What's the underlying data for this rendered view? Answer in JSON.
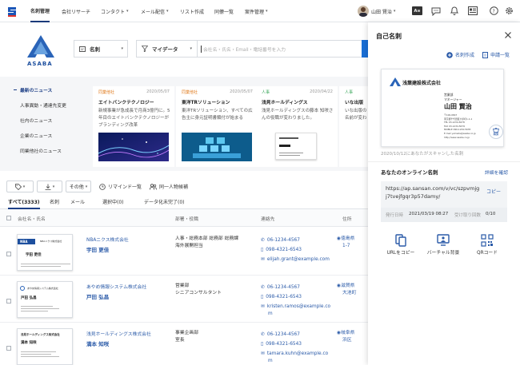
{
  "topnav": {
    "items": [
      "名刺管理",
      "会社リサーチ",
      "コンタクト",
      "メール配信",
      "リスト作成",
      "同僚一覧",
      "案件管理"
    ],
    "user_name": "山田 賢治",
    "caret": "▾"
  },
  "search": {
    "type_label": "名刺",
    "filter_label": "マイデータ",
    "placeholder": "会社名・氏名・Email・電話番号を入力"
  },
  "brand": {
    "logo_text": "ASABA"
  },
  "news_nav": [
    "最新のニュース",
    "人事異動・通達先変更",
    "社内のニュース",
    "企業のニュース",
    "同業他社のニュース"
  ],
  "news_cards": [
    {
      "tag": "同業他社",
      "date": "2020/05/07",
      "title": "エイトバンクテクノロジー",
      "body": "新規事業が急成長で月商3億円に。5年目のエイトバンクテクノロジーがブランディング改革"
    },
    {
      "tag": "同業他社",
      "date": "2020/05/07",
      "title": "東洋TRソリューション",
      "body": "東洋TRソリューション、すべての広告主に身元証明書類付が始まる"
    },
    {
      "tag": "人事",
      "date": "2020/04/22",
      "title": "浅見ホールディングス",
      "body": "浅見ホールディングスの藤本 知咲さんの役職が変わりました。"
    },
    {
      "tag": "人事",
      "date": "",
      "title": "いな出版",
      "body": "いな出版の名前が変わりました。"
    }
  ],
  "toolbar": {
    "tag_label": "",
    "download_label": "",
    "other_label": "その他",
    "reminder_label": "リマインド一覧",
    "same_person_label": "同一人物候補"
  },
  "tabs": [
    "すべて(3333)",
    "名刺",
    "メール",
    "選択中(0)",
    "データ化未完了(0)"
  ],
  "table": {
    "headers": [
      "会社名・氏名",
      "部署・役職",
      "連絡先",
      "住所"
    ],
    "rows": [
      {
        "company": "NBAニクス株式会社",
        "name": "宇田 更佳",
        "dept": [
          "人事・総務本部 総務部 総務課",
          "海外展開担当"
        ],
        "phone": "06-1234-4567",
        "mobile": "098-4321-6543",
        "email": "elijah.grant@example.com",
        "addr": [
          "徳島県",
          "1-7"
        ],
        "card_company": "NBAニクス株式会社",
        "card_name": "宇田 更佳"
      },
      {
        "company": "あやめ情報システム株式会社",
        "name": "戸田 弘昌",
        "dept": [
          "営業部",
          "シニアコンサルタント"
        ],
        "phone": "06-1234-4567",
        "mobile": "098-4321-6543",
        "email": "kristen.ramos@example.co",
        "email2": "m",
        "addr": [
          "滋賀県",
          "大池町"
        ],
        "card_company": "あやめ情報システム株式会社",
        "card_name": "戸田 弘昌"
      },
      {
        "company": "浅見ホールディングス株式会社",
        "name": "満本 知咲",
        "dept": [
          "事業企画部",
          "室長"
        ],
        "phone": "06-1234-4567",
        "mobile": "098-4321-6543",
        "email": "tamara.kuhn@example.co",
        "email2": "m",
        "addr": [
          "岐阜県",
          "浜区"
        ],
        "card_company": "浅見ホールディングス株式会社",
        "card_name": "満本 知咲"
      }
    ]
  },
  "panel": {
    "title": "自己名刺",
    "create_label": "名刺作成",
    "list_label": "申請一覧",
    "card": {
      "company": "浅葉建設株式会社",
      "dept": "営業部",
      "role": "マネージャー",
      "name": "山田 賢治",
      "lines": [
        "〒100-0847",
        "東京都千代田区大手町1-1-1",
        "TEL 03-1234-5678",
        "FAX 03-1234-5679",
        "MOBILE 090-1234-5678",
        "E-mail yamada@asaba.co.jp",
        "http://www.asaba.co.jp"
      ],
      "stamp_label": "編集"
    },
    "scan_note": "2020/10/12にあなたがスキャンした名刺",
    "online_title": "あなたのオンライン名刺",
    "detail_link": "詳細を確認",
    "url": "https://ap.sansan.com/v/vc/szpvmjgj7tvejfgqr3p57damy/",
    "copy_label": "コピー",
    "issued_label": "発行日時",
    "issued_value": "2021/03/19 08:27",
    "received_label": "受け取り回数",
    "received_value": "0/10",
    "actions": [
      "URLをコピー",
      "バーチャル背景",
      "QRコード"
    ]
  }
}
